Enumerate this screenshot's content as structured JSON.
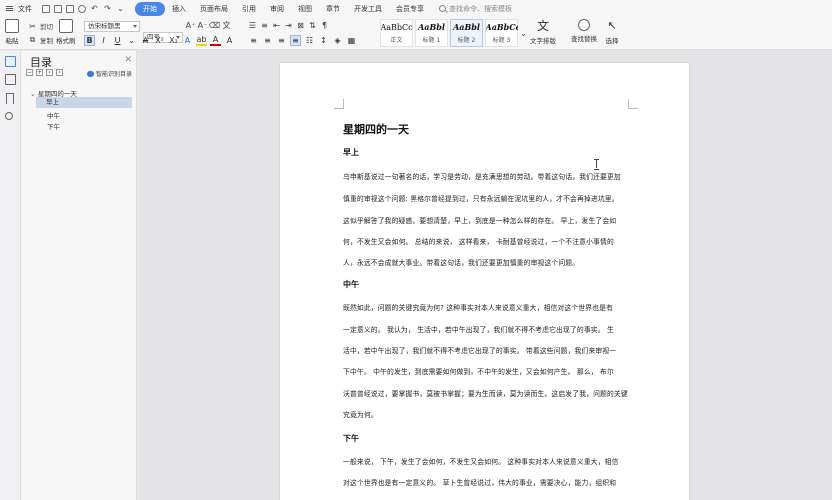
{
  "menubar": {
    "file_label": "文件",
    "menus": [
      "开始",
      "插入",
      "页面布局",
      "引用",
      "审阅",
      "视图",
      "章节",
      "开发工具",
      "会员专享"
    ],
    "active_menu": "开始",
    "search_placeholder": "查找命令、搜索模板"
  },
  "ribbon": {
    "paste": "粘贴",
    "cut": "剪切",
    "copy": "复制",
    "format_painter": "格式刷",
    "font_name": "仿宋标题黑",
    "font_size": "四号",
    "styles": [
      {
        "sample": "AaBbCcDd",
        "name": "正文"
      },
      {
        "sample": "AaBbl",
        "name": "标题 1"
      },
      {
        "sample": "AaBbl",
        "name": "标题 2"
      },
      {
        "sample": "AaBbCc",
        "name": "标题 3"
      }
    ],
    "text_layout": "文字排版",
    "find_replace": "查找替换",
    "select": "选择",
    "accent_color": "#4a86e8"
  },
  "toc": {
    "title": "目录",
    "smart_label": "智能识别目录",
    "items": [
      {
        "label": "星期四的一天",
        "level": 1
      },
      {
        "label": "早上",
        "level": 2,
        "selected": true
      },
      {
        "label": "中午",
        "level": 2
      },
      {
        "label": "下午",
        "level": 2
      }
    ]
  },
  "document": {
    "title": "星期四的一天",
    "sections": [
      {
        "heading": "早上",
        "lines": [
          "乌申斯基说过一句著名的话，学习是劳动，是充满思想的劳动。带着这句话，我们还要更加",
          "慎重的审视这个问题: 黑格尔曾经提到过，只有永远躺在泥坑里的人，才不会再掉进坑里。",
          "这似乎解答了我的疑惑。要想清楚，早上，到底是一种怎么样的存在。 早上，发生了会如",
          "何，不发生又会如何。 总结的来说， 这样看来， 卡耐基曾经说过，一个不注意小事情的",
          "人，永远不会成就大事业。带着这句话，我们还要更加慎重的审视这个问题。"
        ]
      },
      {
        "heading": "中午",
        "lines": [
          "既然如此，问题的关键究竟为何? 这种事实对本人来说意义重大，相信对这个世界也是有",
          "一定意义的。 我认为， 生活中，若中午出现了，我们就不得不考虑它出现了的事实。 生",
          "活中，若中午出现了，我们就不得不考虑它出现了的事实。 带着这些问题，我们来审视一",
          "下中午。 中午的发生，到底需要如何做到，不中午的发生，又会如何产生。 那么， 布尔",
          "沃普曾经说过，要掌握书，莫被书掌握；要为生而读，莫为读而生。这启发了我，问题的关键",
          "究竟为何。"
        ]
      },
      {
        "heading": "下午",
        "lines": [
          "一般来说， 下午，发生了会如何，不发生又会如何。 这种事实对本人来说意义重大，相信",
          "对这个世界也是有一定意义的。 草卜生曾经说过，伟大的事业，需要决心，能力，组织和"
        ]
      }
    ]
  }
}
